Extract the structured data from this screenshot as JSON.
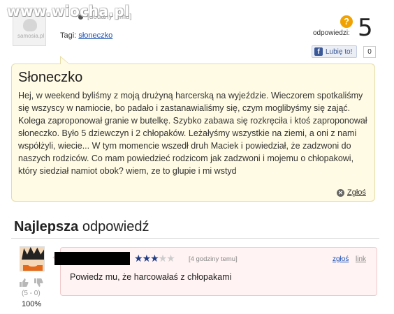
{
  "watermark": "www.wiocha.pl",
  "question": {
    "avatar_label": "samosia.pl",
    "time": "[dodany temu]",
    "tags_label": "Tagi:",
    "tag": "słoneczko",
    "answers_label": "odpowiedzi:",
    "answers_count": "5",
    "like_label": "Lubię to!",
    "like_count": "0",
    "title": "Słoneczko",
    "body": "Hej, w weekend byliśmy z moją drużyną harcerską na wyjeździe. Wieczorem spotkaliśmy się wszyscy w namiocie, bo padało i zastanawialiśmy się, czym moglibyśmy się zająć. Kolega zaproponował granie w butelkę. Szybko zabawa się rozkręciła i ktoś zaproponował słoneczko. Było 5 dziewczyn i 2 chłopaków. Leżałyśmy wszystkie na ziemi, a oni z nami współżyli, wiecie... W tym momencie wszedł druh Maciek i powiedział, że zadzwoni do naszych rodziców. Co mam powiedzieć rodzicom jak zadzwoni i mojemu o chłopakowi, który siedział namiot obok? wiem, ze to glupie i mi wstyd",
    "report_label": "Zgłoś"
  },
  "best_answer": {
    "heading_bold": "Najlepsza",
    "heading_rest": " odpowiedź",
    "rating": 3,
    "rating_max": 5,
    "time": "[4 godziny temu]",
    "report_label": "zgłoś",
    "link_label": "link",
    "text": "Powiedz mu, że harcowałaś z chłopakami",
    "votes": "(5 - 0)",
    "percent": "100%"
  }
}
